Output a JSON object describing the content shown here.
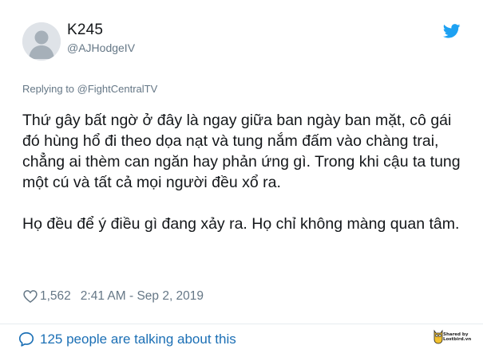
{
  "user": {
    "display_name": "K245",
    "handle": "@AJHodgeIV",
    "avatar_icon": "default-avatar-icon"
  },
  "brand": {
    "logo_icon": "twitter-bird-icon",
    "accent": "#1da1f2"
  },
  "reply": {
    "prefix": "Replying to ",
    "mention": "@FightCentralTV"
  },
  "tweet": {
    "paragraphs": [
      "Thứ gây bất ngờ ở đây là ngay giữa ban ngày ban mặt, cô gái đó hùng hổ đi theo dọa nạt và tung nắm đấm vào chàng trai, chẳng ai thèm can ngăn hay phản ứng gì. Trong khi cậu ta tung một cú và tất cả mọi người đều xổ ra.",
      "Họ đều để ý điều gì đang xảy ra. Họ chỉ không màng quan tâm."
    ]
  },
  "meta": {
    "like_icon": "heart-icon",
    "likes": "1,562",
    "timestamp": "2:41 AM - Sep 2, 2019"
  },
  "footer": {
    "talking_icon": "chat-bubble-icon",
    "talking_text": "125 people are talking about this",
    "link_color": "#1b6fb5"
  },
  "watermark": {
    "line1": "Shared by",
    "line2": "Lostbird.vn"
  }
}
